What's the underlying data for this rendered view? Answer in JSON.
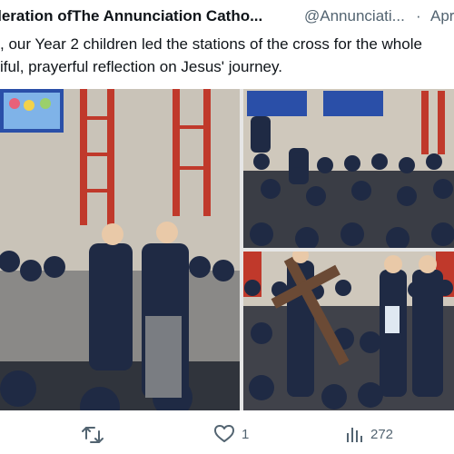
{
  "tweet": {
    "author": "ederation ofThe Annunciation Catho...",
    "handle": "@Annunciati...",
    "separator": "·",
    "date": "Apr",
    "text_lines": [
      ", our Year 2 children led the stations of the cross for the whole",
      "iful, prayerful reflection on Jesus' journey."
    ]
  },
  "actions": {
    "retweet_icon": "retweet-icon",
    "like_icon": "heart-icon",
    "like_count": "1",
    "views_icon": "bar-chart-icon",
    "views_count": "272"
  },
  "colors": {
    "text": "#0f1419",
    "secondary": "#536471"
  }
}
